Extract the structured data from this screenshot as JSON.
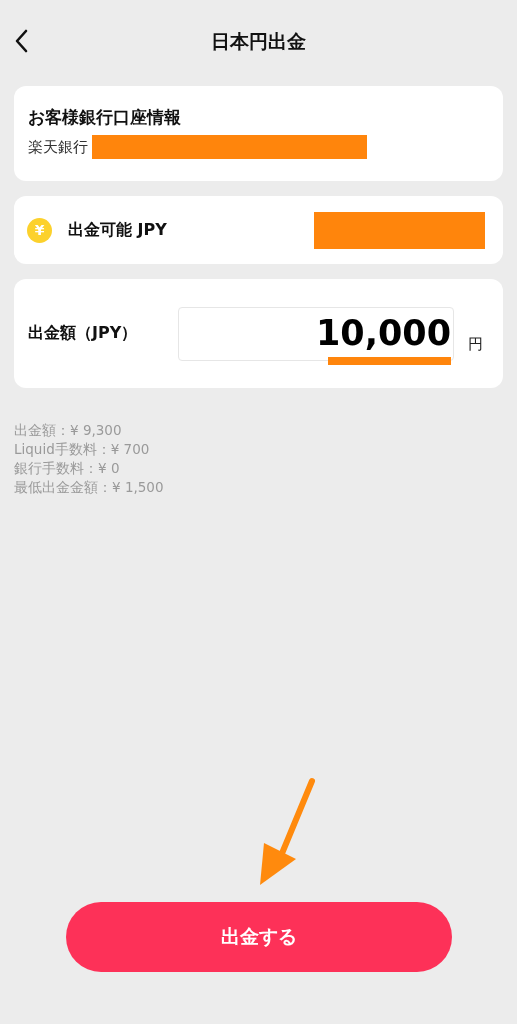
{
  "header": {
    "title": "日本円出金"
  },
  "bank_card": {
    "title": "お客様銀行口座情報",
    "bank": "楽天銀行"
  },
  "balance_card": {
    "icon": "¥",
    "label": "出金可能 JPY"
  },
  "amount_card": {
    "label": "出金額（JPY）",
    "value": "10,000",
    "unit": "円"
  },
  "fees": [
    "出金額：¥ 9,300",
    "Liquid手数料：¥ 700",
    "銀行手数料：¥ 0",
    "最低出金金額：¥ 1,500"
  ],
  "submit_button": "出金する"
}
